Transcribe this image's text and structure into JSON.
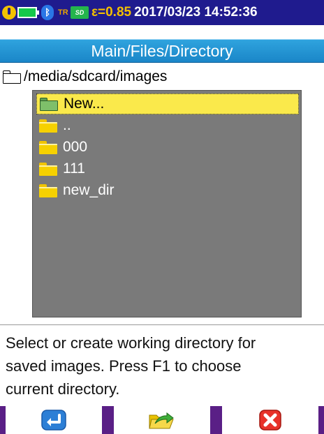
{
  "status_bar": {
    "icons": [
      "power-icon",
      "battery-icon",
      "bluetooth-icon",
      "tr-icon",
      "sd-card-icon"
    ],
    "tr_label": "TR",
    "sd_label": "SD",
    "emissivity": "ε=0.85",
    "datetime": "2017/03/23 14:52:36"
  },
  "title": "Main/Files/Directory",
  "path": "/media/sdcard/images",
  "directory_list": {
    "items": [
      {
        "label": "New...",
        "selected": true,
        "icon": "new-folder-icon"
      },
      {
        "label": "..",
        "selected": false,
        "icon": "folder-icon"
      },
      {
        "label": "000",
        "selected": false,
        "icon": "folder-icon"
      },
      {
        "label": "111",
        "selected": false,
        "icon": "folder-icon"
      },
      {
        "label": "new_dir",
        "selected": false,
        "icon": "folder-icon"
      }
    ]
  },
  "help_text": {
    "lines": [
      "Select or create working directory for",
      "saved images. Press F1 to choose",
      "current directory."
    ]
  },
  "function_keys": [
    {
      "icon": "enter-icon"
    },
    {
      "icon": "open-folder-arrow-icon"
    },
    {
      "icon": "close-icon"
    }
  ],
  "colors": {
    "status_bar_bg": "#1f1b8e",
    "emissivity_text": "#f4c000",
    "title_bar_bg": "#1a86c8",
    "list_bg": "#7a7a7a",
    "selection_bg": "#fae94b",
    "fkey_bar_bg": "#5a1f86"
  }
}
